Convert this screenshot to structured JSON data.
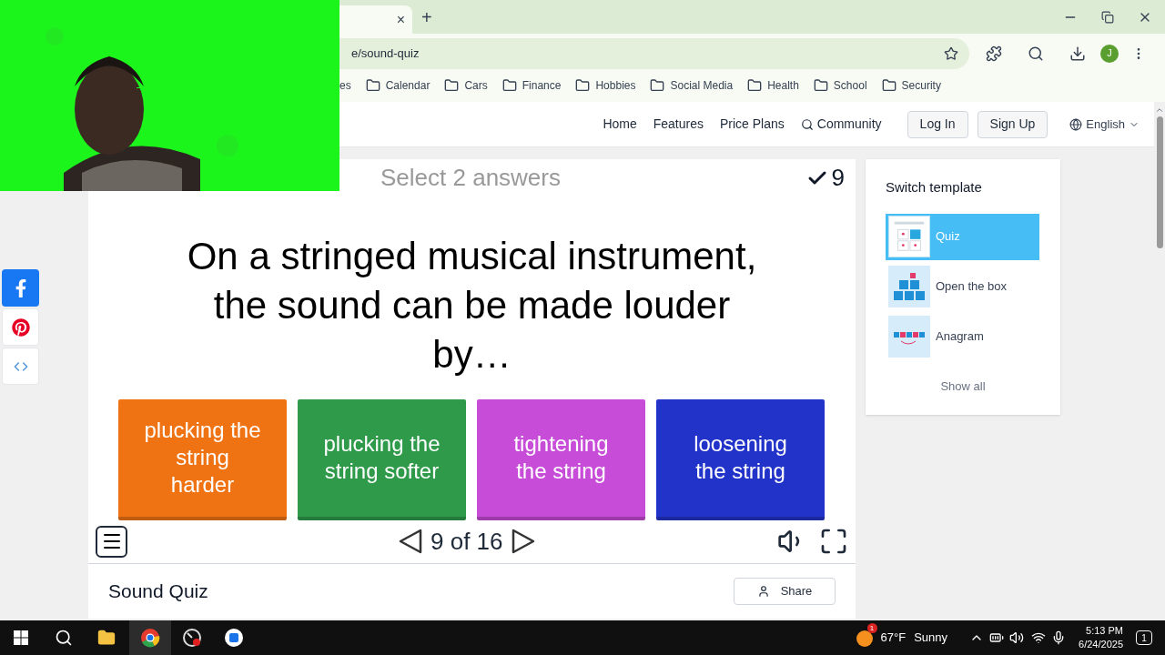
{
  "browser": {
    "tab_close": "×",
    "new_tab": "+",
    "address": "e/sound-quiz",
    "avatar": "J",
    "bookmarks": [
      "es",
      "Calendar",
      "Cars",
      "Finance",
      "Hobbies",
      "Social Media",
      "Health",
      "School",
      "Security"
    ]
  },
  "nav": {
    "links": [
      "Home",
      "Features",
      "Price Plans",
      "Community"
    ],
    "login": "Log In",
    "signup": "Sign Up",
    "language": "English"
  },
  "social": [
    {
      "kind": "facebook"
    },
    {
      "kind": "pinterest"
    },
    {
      "kind": "embed"
    }
  ],
  "quiz": {
    "instruction": "Select 2 answers",
    "score": "9",
    "question": "On a stringed musical instrument, the sound can be made louder by…",
    "answers": [
      {
        "text": "plucking the string harder",
        "color": "#f07313"
      },
      {
        "text": "plucking the string softer",
        "color": "#2e9a4a"
      },
      {
        "text": "tightening the string",
        "color": "#c74cd8"
      },
      {
        "text": "loosening the string",
        "color": "#2233c9"
      }
    ],
    "progress": "9 of 16"
  },
  "activity": {
    "title": "Sound Quiz",
    "share": "Share"
  },
  "templates": {
    "title": "Switch template",
    "items": [
      {
        "label": "Quiz",
        "kind": "quiz",
        "selected": true
      },
      {
        "label": "Open the box",
        "kind": "box",
        "selected": false
      },
      {
        "label": "Anagram",
        "kind": "anagram",
        "selected": false
      }
    ],
    "show_all": "Show all"
  },
  "taskbar": {
    "temperature": "67°F",
    "weather": "Sunny",
    "weather_badge": "1",
    "time": "5:13 PM",
    "date": "6/24/2025",
    "notifications": "1"
  }
}
